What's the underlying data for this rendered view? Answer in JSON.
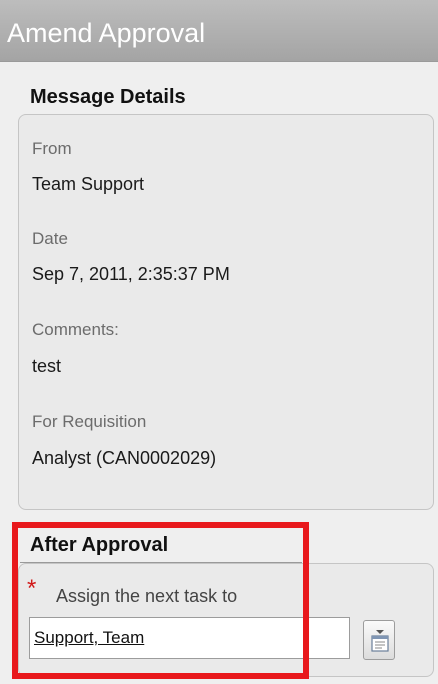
{
  "header": {
    "title": "Amend Approval"
  },
  "message_details": {
    "heading": "Message Details",
    "from_label": "From",
    "from_value": "Team Support",
    "date_label": "Date",
    "date_value": "Sep 7, 2011, 2:35:37 PM",
    "comments_label": "Comments:",
    "comments_value": "test",
    "requisition_label": "For Requisition",
    "requisition_value": "Analyst (CAN0002029)"
  },
  "after_approval": {
    "heading": "After Approval",
    "required_marker": "*",
    "assign_label": "Assign the next task to",
    "assign_value": "Support, Team",
    "lookup_icon": "calendar-lookup-icon"
  },
  "colors": {
    "highlight": "#e8181c",
    "title_bar": "#b1b1b1",
    "required": "#d11a1a"
  }
}
